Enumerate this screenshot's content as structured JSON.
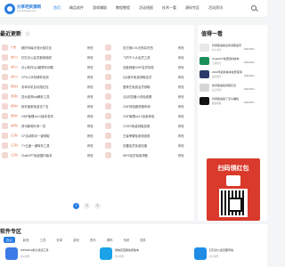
{
  "site": {
    "brand": "分享吧资源网",
    "brand_sub": "www.fxbaogao.com"
  },
  "nav": {
    "items": [
      {
        "label": "首页",
        "active": true
      },
      {
        "label": "精品软件",
        "active": false
      },
      {
        "label": "游戏辅助",
        "active": false
      },
      {
        "label": "教程教程",
        "active": false
      },
      {
        "label": "活动线报",
        "active": false
      },
      {
        "label": "技术一看",
        "active": false
      },
      {
        "label": "源码专区",
        "active": false
      },
      {
        "label": "活动资讯",
        "active": false
      }
    ]
  },
  "main": {
    "title": "最近更新",
    "rows": [
      {
        "left": {
          "tag": "广告",
          "title": "超好玩每天领大奖红包",
          "cat": "教程"
        },
        "right": {
          "tag": "",
          "title": "支付宝0.01元购买东西",
          "cat": "教程"
        }
      },
      {
        "left": {
          "tag": "[办公]",
          "title": "钉钉办公会员都用啥呢",
          "cat": "教程"
        },
        "right": {
          "tag": "",
          "title": "飞书千人大会员工资",
          "cat": "教程"
        }
      },
      {
        "left": {
          "tag": "[办公]",
          "title": "办公软件QQ都是有问题",
          "cat": "教程"
        },
        "right": {
          "tag": "",
          "title": "百度网盘SVIP会员特权",
          "cat": "教程"
        }
      },
      {
        "left": {
          "tag": "[办公]",
          "title": "CPU-Z手机硬件检测",
          "cat": "教程"
        },
        "right": {
          "tag": "",
          "title": "QQ音乐免费领取会员",
          "cat": "教程"
        }
      },
      {
        "left": {
          "tag": "[安卓]",
          "title": "安卓手机自动抢红包",
          "cat": "教程"
        },
        "right": {
          "tag": "",
          "title": "爱奇艺免费会员领取",
          "cat": "教程"
        }
      },
      {
        "left": {
          "tag": "[影音]",
          "title": "四大影视vip解析工具",
          "cat": "教程"
        },
        "right": {
          "tag": "",
          "title": "QQ浏览器小说免费看",
          "cat": "教程"
        }
      },
      {
        "left": {
          "tag": "[安卓]",
          "title": "软件管家免费去广告",
          "cat": "教程"
        },
        "right": {
          "tag": "",
          "title": "CNF体验服资格申请",
          "cat": "教程"
        }
      },
      {
        "left": {
          "tag": "[安卓]",
          "title": "OMF管理vs2.0版本发布",
          "cat": "教程"
        },
        "right": {
          "tag": "",
          "title": "CNF管理vs2.0全新体验",
          "cat": "教程"
        }
      },
      {
        "left": {
          "tag": "[资讯]",
          "title": "资讯新闻头条一览",
          "cat": "教程"
        },
        "right": {
          "tag": "",
          "title": "CSGO免费领取皮肤",
          "cat": "教程"
        }
      },
      {
        "left": {
          "tag": "[工具]",
          "title": "CF活动助手一键领取",
          "cat": "教程"
        },
        "right": {
          "tag": "",
          "title": "王者荣耀免费领皮肤",
          "cat": "教程"
        }
      },
      {
        "left": {
          "tag": "[工具]",
          "title": "YY云盘一键转存工具",
          "cat": "教程"
        },
        "right": {
          "tag": "",
          "title": "迅雷会员免费加速",
          "cat": "教程"
        }
      },
      {
        "left": {
          "tag": "[工具]",
          "title": "ChatGPT免费国内版本",
          "cat": "教程"
        },
        "right": {
          "tag": "",
          "title": "WPS会员免费领取",
          "cat": "教程"
        }
      }
    ],
    "pages": [
      "1",
      "2",
      "3"
    ],
    "current_page": "1"
  },
  "side": {
    "title": "值得一看",
    "items": [
      {
        "line1": "抖音极速版全新领取金币",
        "line2": "新人专享",
        "date": "2022-08-2"
      },
      {
        "line1": "ChatGPT免费国内版本",
        "line2": "无需账号",
        "date": "2022-08-2"
      },
      {
        "line1": "2022年最新版本免费使用",
        "line2": "最新推荐",
        "date": "2022-08-1"
      },
      {
        "line1": "快手极速版领取红包",
        "line2": "每日签到",
        "date": "2022-08-1"
      },
      {
        "line1": "抖音极速版了怎么赚钱",
        "line2": "赚钱攻略",
        "date": "2022-08-1"
      }
    ],
    "promo_title": "扫码领红包"
  },
  "bottom": {
    "title": "软件专区",
    "tabs": [
      {
        "label": "办公",
        "active": true
      },
      {
        "label": "影音",
        "active": false
      },
      {
        "label": "工具",
        "active": false
      },
      {
        "label": "安卓",
        "active": false
      },
      {
        "label": "游戏",
        "active": false
      },
      {
        "label": "资讯",
        "active": false
      },
      {
        "label": "源码",
        "active": false
      },
      {
        "label": "系统",
        "active": false
      },
      {
        "label": "插件",
        "active": false
      }
    ],
    "apps": [
      {
        "title": "WPS2019永久激活工具",
        "tag": "办公软件"
      },
      {
        "title": "微信百宝箱免费版本",
        "tag": "办公软件"
      },
      {
        "title": "钉钉办公会员都有啥",
        "tag": "办公软件"
      }
    ]
  }
}
